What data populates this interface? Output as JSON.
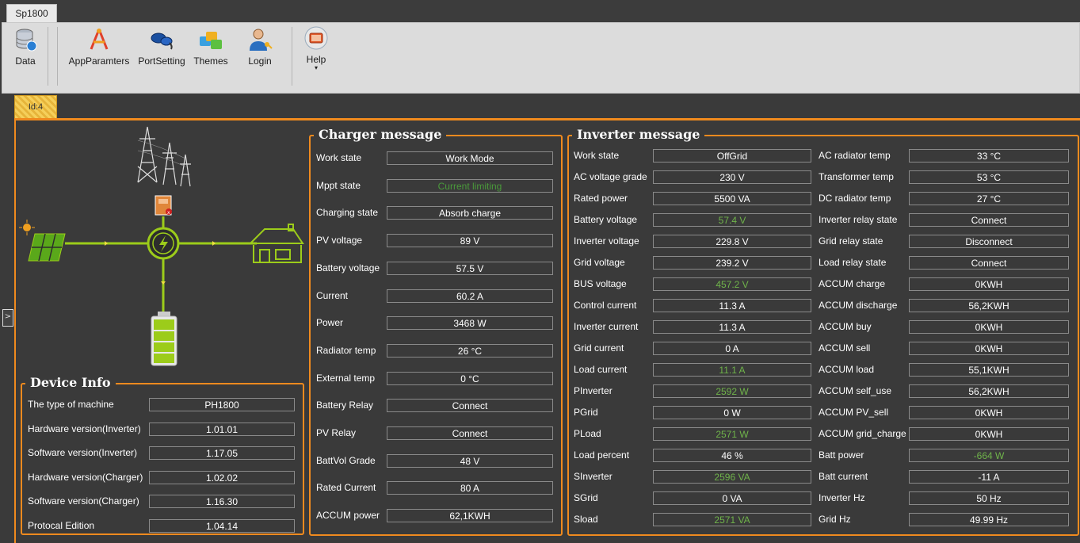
{
  "app": {
    "tab": "Sp1800"
  },
  "ribbon": {
    "buttons": [
      {
        "label": "Data",
        "icon": "database-icon"
      },
      {
        "label": "AppParamters",
        "icon": "compass-icon"
      },
      {
        "label": "PortSetting",
        "icon": "cable-icon"
      },
      {
        "label": "Themes",
        "icon": "themes-icon"
      },
      {
        "label": "Login",
        "icon": "user-key-icon"
      },
      {
        "label": "Help",
        "icon": "help-icon",
        "dropdown": "▾"
      }
    ]
  },
  "doc_tab": "Id:4",
  "side_toggle": ">",
  "device_info": {
    "title": "Device Info",
    "rows": [
      {
        "label": "The type of machine",
        "value": "PH1800"
      },
      {
        "label": "Hardware version(Inverter)",
        "value": "1.01.01"
      },
      {
        "label": "Software version(Inverter)",
        "value": "1.17.05"
      },
      {
        "label": "Hardware version(Charger)",
        "value": "1.02.02"
      },
      {
        "label": "Software version(Charger)",
        "value": "1.16.30"
      },
      {
        "label": "Protocal Edition",
        "value": "1.04.14"
      }
    ]
  },
  "charger": {
    "title": "Charger message",
    "rows": [
      {
        "label": "Work state",
        "value": "Work Mode"
      },
      {
        "label": "Mppt state",
        "value": "Current limiting",
        "color": "#4a9a3a"
      },
      {
        "label": "Charging state",
        "value": "Absorb charge"
      },
      {
        "label": "PV voltage",
        "value": "89 V"
      },
      {
        "label": "Battery voltage",
        "value": "57.5 V"
      },
      {
        "label": "Current",
        "value": "60.2 A"
      },
      {
        "label": "Power",
        "value": "3468 W"
      },
      {
        "label": "Radiator temp",
        "value": "26 °C"
      },
      {
        "label": "External temp",
        "value": "0 °C"
      },
      {
        "label": "Battery Relay",
        "value": "Connect"
      },
      {
        "label": "PV Relay",
        "value": "Connect"
      },
      {
        "label": "BattVol Grade",
        "value": "48 V"
      },
      {
        "label": "Rated Current",
        "value": "80 A"
      },
      {
        "label": "ACCUM power",
        "value": "62,1KWH"
      }
    ]
  },
  "inverter": {
    "title": "Inverter message",
    "left": [
      {
        "label": "Work state",
        "value": "OffGrid"
      },
      {
        "label": "AC voltage grade",
        "value": "230 V"
      },
      {
        "label": "Rated power",
        "value": "5500 VA"
      },
      {
        "label": "Battery voltage",
        "value": "57.4 V",
        "color": "#6fb34a"
      },
      {
        "label": "Inverter voltage",
        "value": "229.8 V"
      },
      {
        "label": "Grid voltage",
        "value": "239.2 V"
      },
      {
        "label": "BUS voltage",
        "value": "457.2 V",
        "color": "#6fb34a"
      },
      {
        "label": "Control current",
        "value": "11.3 A"
      },
      {
        "label": "Inverter current",
        "value": "11.3 A"
      },
      {
        "label": "Grid current",
        "value": "0 A"
      },
      {
        "label": "Load current",
        "value": "11.1 A",
        "color": "#6fb34a"
      },
      {
        "label": "PInverter",
        "value": "2592 W",
        "color": "#6fb34a"
      },
      {
        "label": "PGrid",
        "value": "0 W"
      },
      {
        "label": "PLoad",
        "value": "2571 W",
        "color": "#6fb34a"
      },
      {
        "label": "Load percent",
        "value": "46 %"
      },
      {
        "label": "SInverter",
        "value": "2596 VA",
        "color": "#6fb34a"
      },
      {
        "label": "SGrid",
        "value": "0 VA"
      },
      {
        "label": "Sload",
        "value": "2571 VA",
        "color": "#6fb34a"
      }
    ],
    "right": [
      {
        "label": "AC radiator temp",
        "value": "33 °C"
      },
      {
        "label": "Transformer temp",
        "value": "53 °C"
      },
      {
        "label": "DC radiator temp",
        "value": "27 °C"
      },
      {
        "label": "Inverter relay state",
        "value": "Connect"
      },
      {
        "label": "Grid relay state",
        "value": "Disconnect"
      },
      {
        "label": "Load relay state",
        "value": "Connect"
      },
      {
        "label": "ACCUM charge",
        "value": "0KWH"
      },
      {
        "label": "ACCUM discharge",
        "value": "56,2KWH"
      },
      {
        "label": "ACCUM buy",
        "value": "0KWH"
      },
      {
        "label": "ACCUM sell",
        "value": "0KWH"
      },
      {
        "label": "ACCUM load",
        "value": "55,1KWH"
      },
      {
        "label": "ACCUM self_use",
        "value": "56,2KWH"
      },
      {
        "label": "ACCUM PV_sell",
        "value": "0KWH"
      },
      {
        "label": "ACCUM grid_charge",
        "value": "0KWH"
      },
      {
        "label": "Batt power",
        "value": "-664 W",
        "color": "#6fb34a"
      },
      {
        "label": "Batt current",
        "value": "-11 A"
      },
      {
        "label": "Inverter Hz",
        "value": "50 Hz"
      },
      {
        "label": "Grid Hz",
        "value": "49.99 Hz"
      }
    ]
  },
  "colors": {
    "accent": "#f08a1e",
    "flow": "#9ccc1a",
    "panel_bg": "#3a3a3a"
  }
}
